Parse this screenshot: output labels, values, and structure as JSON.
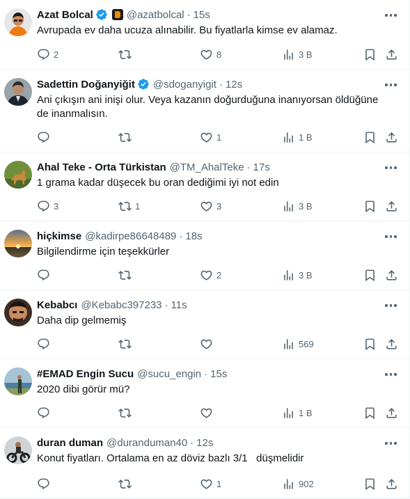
{
  "tweets": [
    {
      "name": "Azat Bolcal",
      "handle": "@azatbolcal",
      "time": "15s",
      "text": "Avrupada ev daha ucuza alınabilir. Bu fiyatlarla kimse ev alamaz.",
      "verified": true,
      "affiliate": true,
      "replies": "2",
      "retweets": "",
      "likes": "8",
      "views": "3 B",
      "avatar": "avatar-orange-hoodie"
    },
    {
      "name": "Sadettin Doğanyiğit",
      "handle": "@sdoganyigit",
      "time": "12s",
      "text": "Ani çıkışın ani inişi olur. Veya kazanın doğurduğuna inanıyorsan öldüğüne de inanmalısın.",
      "verified": true,
      "affiliate": false,
      "replies": "",
      "retweets": "",
      "likes": "1",
      "views": "1 B",
      "avatar": "avatar-man-suit"
    },
    {
      "name": "Ahal Teke - Orta Türkistan",
      "handle": "@TM_AhalTeke",
      "time": "17s",
      "text": "1 grama kadar düşecek bu oran dediğimi iyi not edin",
      "verified": false,
      "affiliate": false,
      "replies": "3",
      "retweets": "1",
      "likes": "3",
      "views": "3 B",
      "avatar": "avatar-horse"
    },
    {
      "name": "hiçkimse",
      "handle": "@kadirpe86648489",
      "time": "18s",
      "text": "Bilgilendirme için teşekkürler",
      "verified": false,
      "affiliate": false,
      "replies": "",
      "retweets": "",
      "likes": "2",
      "views": "3 B",
      "avatar": "avatar-sunset"
    },
    {
      "name": "Kebabcı",
      "handle": "@Kebabc397233",
      "time": "11s",
      "text": "Daha dip gelmemiş",
      "verified": false,
      "affiliate": false,
      "replies": "",
      "retweets": "",
      "likes": "",
      "views": "569",
      "avatar": "avatar-man-face"
    },
    {
      "name": "#EMAD Engin Sucu",
      "handle": "@sucu_engin",
      "time": "15s",
      "text": "2020 dibi görür mü?",
      "verified": false,
      "affiliate": false,
      "replies": "",
      "retweets": "",
      "likes": "",
      "views": "1 B",
      "avatar": "avatar-seaside"
    },
    {
      "name": "duran duman",
      "handle": "@duranduman40",
      "time": "12s",
      "text": "Konut fiyatları. Ortalama en az döviz bazlı 3/1   düşmelidir",
      "verified": false,
      "affiliate": false,
      "replies": "",
      "retweets": "",
      "likes": "1",
      "views": "902",
      "avatar": "avatar-motorcycle"
    }
  ],
  "separator": "·",
  "colors": {
    "text": "#0f1419",
    "secondary": "#536471",
    "verified": "#1d9bf0",
    "border": "#eff3f4"
  }
}
